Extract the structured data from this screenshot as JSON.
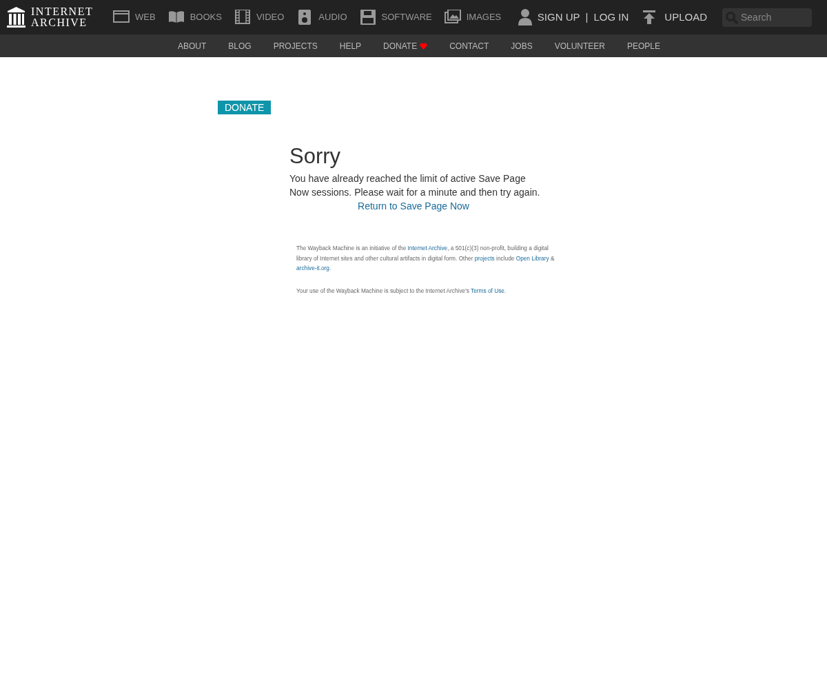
{
  "logo": {
    "line_1": "INTERNET",
    "line_2": "ARCHIVE"
  },
  "media_nav": [
    {
      "kind": "web",
      "label": "WEB"
    },
    {
      "kind": "books",
      "label": "BOOKS"
    },
    {
      "kind": "video",
      "label": "VIDEO"
    },
    {
      "kind": "audio",
      "label": "AUDIO"
    },
    {
      "kind": "software",
      "label": "SOFTWARE"
    },
    {
      "kind": "images",
      "label": "IMAGES"
    }
  ],
  "account": {
    "sign_up": "SIGN UP",
    "separator": "|",
    "log_in": "LOG IN",
    "upload": "UPLOAD"
  },
  "search": {
    "placeholder": "Search"
  },
  "sub_nav": [
    {
      "label": "ABOUT",
      "heart": false
    },
    {
      "label": "BLOG",
      "heart": false
    },
    {
      "label": "PROJECTS",
      "heart": false
    },
    {
      "label": "HELP",
      "heart": false
    },
    {
      "label": "DONATE",
      "heart": true
    },
    {
      "label": "CONTACT",
      "heart": false
    },
    {
      "label": "JOBS",
      "heart": false
    },
    {
      "label": "VOLUNTEER",
      "heart": false
    },
    {
      "label": "PEOPLE",
      "heart": false
    }
  ],
  "donate_button": "DONATE",
  "heading": "Sorry",
  "message": "You have already reached the limit of active Save Page Now sessions. Please wait for a minute and then try again.",
  "return_link": "Return to Save Page Now",
  "footer": [
    [
      {
        "text": "The Wayback Machine is an initiative of the ",
        "link": false
      },
      {
        "text": "Internet Archive",
        "link": true
      },
      {
        "text": ", a 501(c)(3) non-profit, building a digital library of Internet sites and other cultural artifacts in digital form. Other ",
        "link": false
      },
      {
        "text": "projects",
        "link": true
      },
      {
        "text": " include ",
        "link": false
      },
      {
        "text": "Open Library",
        "link": true
      },
      {
        "text": " & ",
        "link": false
      },
      {
        "text": "archive-it.org",
        "link": true
      },
      {
        "text": ".",
        "link": false
      }
    ],
    [
      {
        "text": "Your use of the Wayback Machine is subject to the Internet Archive's ",
        "link": false
      },
      {
        "text": "Terms of Use",
        "link": true
      },
      {
        "text": ".",
        "link": false
      }
    ]
  ]
}
